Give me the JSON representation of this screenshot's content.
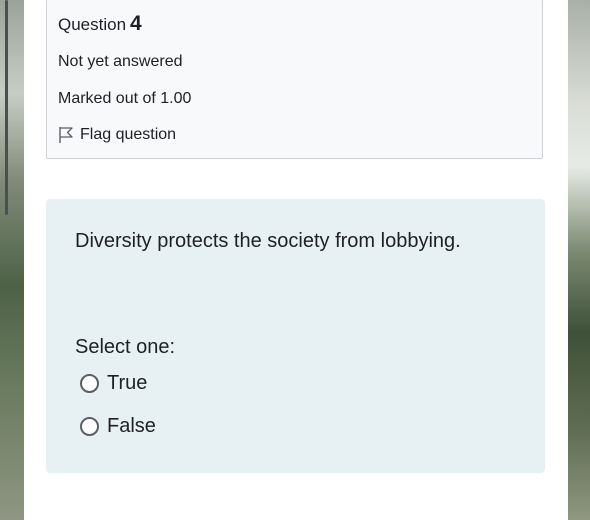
{
  "question_info": {
    "question_label": "Question",
    "question_number": "4",
    "status": "Not yet answered",
    "marks": "Marked out of 1.00",
    "flag_label": "Flag question",
    "flag_icon": "flag-outline-icon"
  },
  "question": {
    "text": "Diversity protects the society from lobbying.",
    "prompt": "Select one:",
    "options": [
      {
        "label": "True",
        "selected": false
      },
      {
        "label": "False",
        "selected": false
      }
    ]
  },
  "colors": {
    "info_background": "#f8f9fa",
    "question_background": "#e7f0f3",
    "text": "#1d2125"
  }
}
